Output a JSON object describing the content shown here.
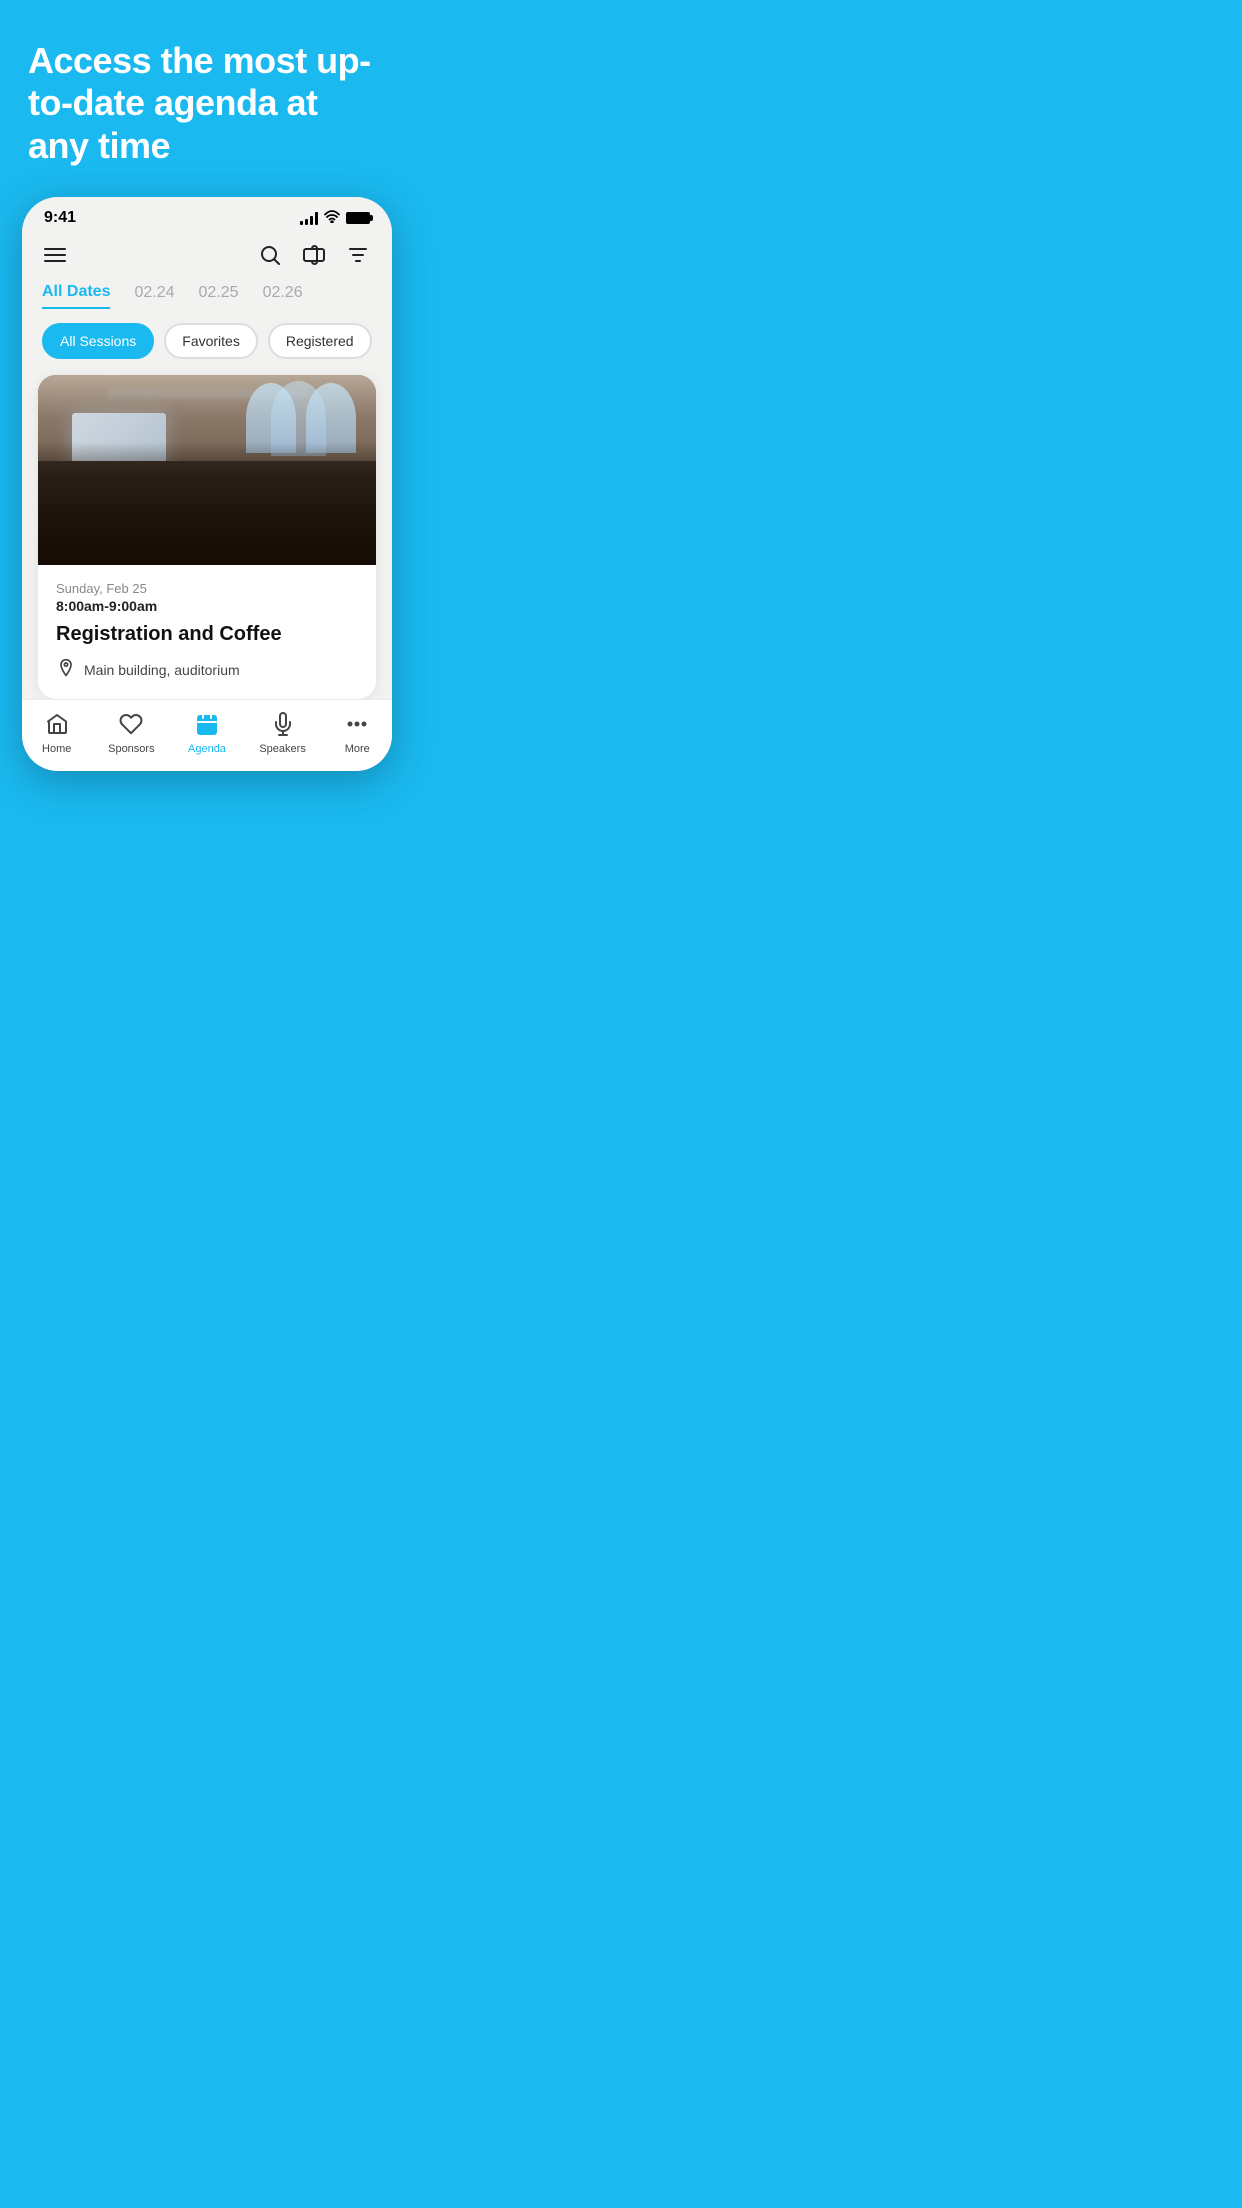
{
  "hero": {
    "title": "Access the most up-to-date agenda at any time"
  },
  "statusBar": {
    "time": "9:41"
  },
  "header": {
    "searchLabel": "Search",
    "ticketLabel": "Ticket",
    "filterLabel": "Filter"
  },
  "dateTabs": [
    {
      "label": "All Dates",
      "active": true
    },
    {
      "label": "02.24",
      "active": false
    },
    {
      "label": "02.25",
      "active": false
    },
    {
      "label": "02.26",
      "active": false
    }
  ],
  "sessionFilters": [
    {
      "label": "All Sessions",
      "active": true
    },
    {
      "label": "Favorites",
      "active": false
    },
    {
      "label": "Registered",
      "active": false
    }
  ],
  "sessionCard": {
    "date": "Sunday, Feb 25",
    "time": "8:00am-9:00am",
    "title": "Registration and Coffee",
    "location": "Main building, auditorium"
  },
  "bottomNav": [
    {
      "id": "home",
      "label": "Home",
      "active": false
    },
    {
      "id": "sponsors",
      "label": "Sponsors",
      "active": false
    },
    {
      "id": "agenda",
      "label": "Agenda",
      "active": true
    },
    {
      "id": "speakers",
      "label": "Speakers",
      "active": false
    },
    {
      "id": "more",
      "label": "More",
      "active": false
    }
  ]
}
